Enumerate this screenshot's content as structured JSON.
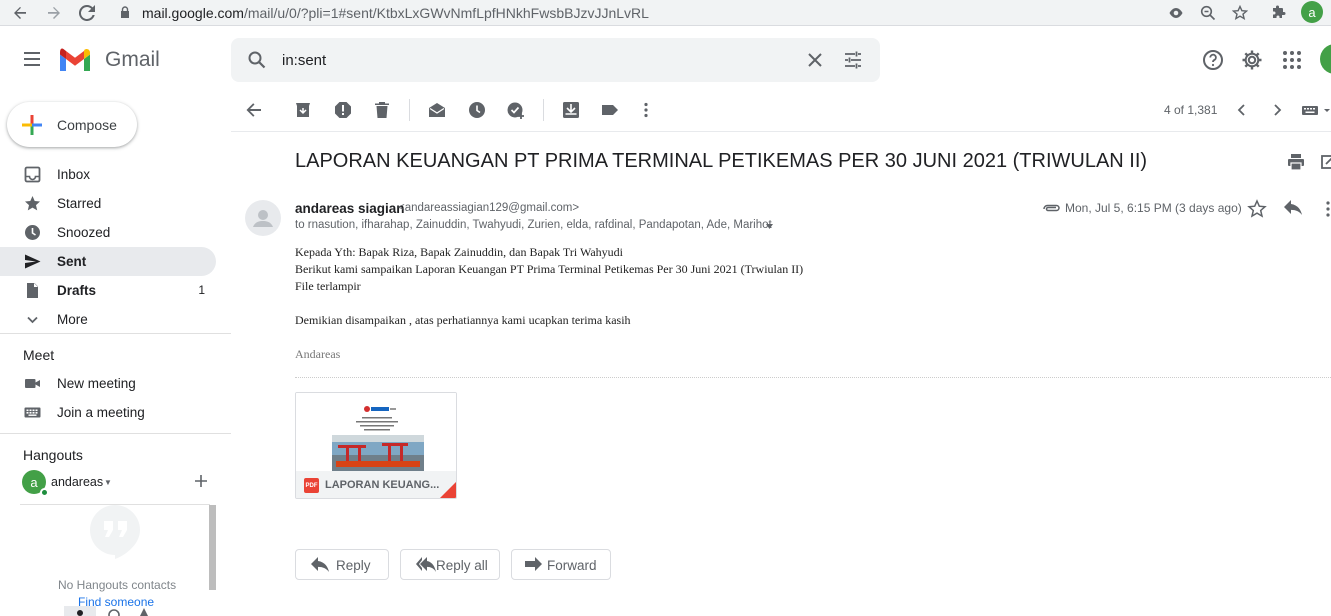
{
  "browser": {
    "url_host": "mail.google.com",
    "url_path": "/mail/u/0/?pli=1#sent/KtbxLxGWvNmfLpfHNkhFwsbBJzvJJnLvRL",
    "profile_initial": "a"
  },
  "app": {
    "name": "Gmail",
    "accent": "#1a73e8"
  },
  "search": {
    "query": "in:sent"
  },
  "sidebar": {
    "compose_label": "Compose",
    "items": [
      {
        "label": "Inbox",
        "icon": "inbox-icon"
      },
      {
        "label": "Starred",
        "icon": "star-icon"
      },
      {
        "label": "Snoozed",
        "icon": "clock-icon"
      },
      {
        "label": "Sent",
        "icon": "send-icon",
        "active": true
      },
      {
        "label": "Drafts",
        "icon": "draft-icon",
        "count": "1"
      },
      {
        "label": "More",
        "icon": "chevron-down-icon"
      }
    ],
    "meet": {
      "title": "Meet",
      "items": [
        {
          "label": "New meeting",
          "icon": "video-icon"
        },
        {
          "label": "Join a meeting",
          "icon": "keyboard-icon"
        }
      ]
    },
    "hangouts": {
      "title": "Hangouts",
      "user_initial": "a",
      "user_name": "andareas",
      "empty_text": "No Hangouts contacts",
      "find_link": "Find someone"
    }
  },
  "toolbar": {
    "pager": "4 of 1,381"
  },
  "message": {
    "subject": "LAPORAN KEUANGAN PT PRIMA TERMINAL PETIKEMAS PER 30 JUNI 2021 (TRIWULAN II)",
    "sender_name": "andareas siagian",
    "sender_email": "<andareassiagian129@gmail.com>",
    "to": "to rnasution, ifharahap, Zainuddin, Twahyudi, Zurien, elda, rafdinal, Pandapotan, Ade, Marihot",
    "date": "Mon, Jul 5, 6:15 PM (3 days ago)",
    "body": [
      "Kepada Yth: Bapak Riza, Bapak Zainuddin, dan Bapak Tri Wahyudi",
      "Berikut kami sampaikan Laporan Keuangan PT Prima Terminal Petikemas Per 30 Juni  2021 (Trwiulan II)",
      "File terlampir",
      "Demikian disampaikan , atas perhatiannya kami ucapkan terima kasih"
    ],
    "signature": "Andareas",
    "attachment": {
      "name": "LAPORAN KEUANG...",
      "type_badge": "PDF"
    }
  },
  "actions": {
    "reply": "Reply",
    "reply_all": "Reply all",
    "forward": "Forward"
  }
}
